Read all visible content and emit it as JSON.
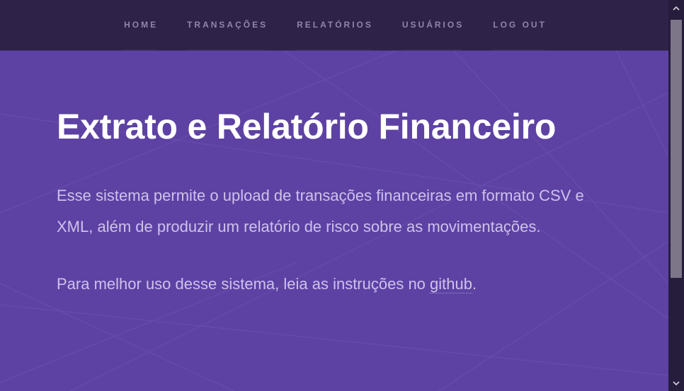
{
  "nav": {
    "items": [
      {
        "label": "HOME"
      },
      {
        "label": "TRANSAÇÕES"
      },
      {
        "label": "RELATÓRIOS"
      },
      {
        "label": "USUÁRIOS"
      },
      {
        "label": "LOG OUT"
      }
    ]
  },
  "hero": {
    "title": "Extrato e Relatório Financeiro",
    "description": "Esse sistema permite o upload de transações financeiras em formato CSV e XML, além de produzir um relatório de risco sobre as movimentações.",
    "instructions_prefix": "Para melhor uso desse sistema, leia as instruções no ",
    "instructions_link": "github",
    "instructions_suffix": "."
  },
  "colors": {
    "navbar": "#2e2249",
    "hero_background": "#5d42a4",
    "title_text": "#ffffff",
    "body_text": "#cec2ea",
    "nav_text": "#8f86a6"
  },
  "icons": {
    "scroll_up": "chevron-up-icon",
    "scroll_down": "chevron-down-icon"
  }
}
